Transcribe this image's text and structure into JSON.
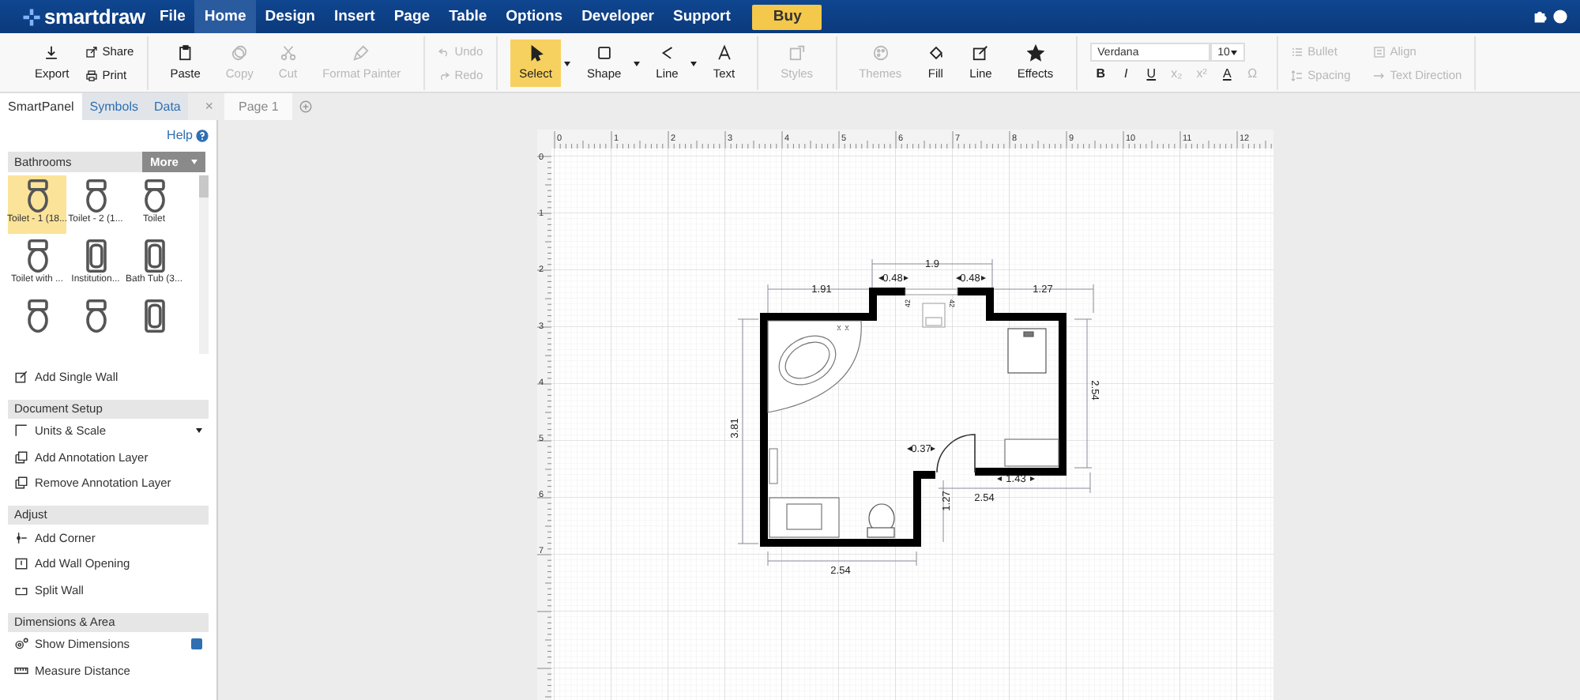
{
  "top_bar": {
    "logo": "smartdraw",
    "menu": [
      {
        "label": "File",
        "selected": false
      },
      {
        "label": "Home",
        "selected": true
      },
      {
        "label": "Design",
        "selected": false
      },
      {
        "label": "Insert",
        "selected": false
      },
      {
        "label": "Page",
        "selected": false
      },
      {
        "label": "Table",
        "selected": false
      },
      {
        "label": "Options",
        "selected": false
      },
      {
        "label": "Developer",
        "selected": false
      },
      {
        "label": "Support",
        "selected": false
      }
    ],
    "buy_button": "Buy"
  },
  "ribbon": {
    "groups": [
      {
        "kind": "buttons",
        "items": [
          {
            "label": "Export",
            "kind": "large",
            "disabled": false,
            "selected": false,
            "dropdown": false
          },
          {
            "label": "Share",
            "kind": "small",
            "disabled": false,
            "selected": false,
            "dropdown": false
          },
          {
            "label": "Print",
            "kind": "small",
            "disabled": false,
            "selected": false,
            "dropdown": false
          }
        ]
      },
      {
        "kind": "buttons",
        "items": [
          {
            "label": "Paste",
            "kind": "large",
            "disabled": false,
            "selected": false,
            "dropdown": false
          },
          {
            "label": "Copy",
            "kind": "large",
            "disabled": true,
            "selected": false,
            "dropdown": false
          },
          {
            "label": "Cut",
            "kind": "large",
            "disabled": true,
            "selected": false,
            "dropdown": false
          },
          {
            "label": "Format Painter",
            "kind": "large",
            "disabled": true,
            "selected": false,
            "dropdown": false
          }
        ]
      },
      {
        "kind": "buttons",
        "items": [
          {
            "label": "Undo",
            "kind": "small",
            "disabled": true,
            "selected": false,
            "dropdown": false
          },
          {
            "label": "Redo",
            "kind": "small",
            "disabled": true,
            "selected": false,
            "dropdown": false
          }
        ]
      },
      {
        "kind": "buttons",
        "items": [
          {
            "label": "Select",
            "kind": "large",
            "disabled": false,
            "selected": true,
            "dropdown": true
          },
          {
            "label": "Shape",
            "kind": "large",
            "disabled": false,
            "selected": false,
            "dropdown": true
          },
          {
            "label": "Line",
            "kind": "large",
            "disabled": false,
            "selected": false,
            "dropdown": true
          },
          {
            "label": "Text",
            "kind": "large",
            "disabled": false,
            "selected": false,
            "dropdown": false
          }
        ]
      },
      {
        "kind": "buttons",
        "items": [
          {
            "label": "Styles",
            "kind": "large",
            "disabled": true,
            "selected": false,
            "dropdown": false
          }
        ]
      },
      {
        "kind": "buttons",
        "items": [
          {
            "label": "Themes",
            "kind": "large",
            "disabled": true,
            "selected": false,
            "dropdown": false
          },
          {
            "label": "Fill",
            "kind": "large",
            "disabled": false,
            "selected": false,
            "dropdown": false
          },
          {
            "label": "Line",
            "kind": "large",
            "disabled": false,
            "selected": false,
            "dropdown": false
          },
          {
            "label": "Effects",
            "kind": "large",
            "disabled": false,
            "selected": false,
            "dropdown": false
          }
        ]
      },
      {
        "kind": "font",
        "font": "Verdana",
        "size": "10",
        "formats": [
          {
            "label": "B",
            "disabled": false
          },
          {
            "label": "I",
            "disabled": false
          },
          {
            "label": "U",
            "disabled": false
          },
          {
            "label": "x₂",
            "disabled": true
          },
          {
            "label": "x²",
            "disabled": true
          },
          {
            "label": "A",
            "disabled": false
          },
          {
            "label": "Ω",
            "disabled": true
          }
        ]
      },
      {
        "kind": "buttons",
        "items": [
          {
            "label": "Bullet",
            "kind": "small",
            "disabled": true,
            "selected": false,
            "dropdown": false
          },
          {
            "label": "Spacing",
            "kind": "small",
            "disabled": true,
            "selected": false,
            "dropdown": false
          },
          {
            "label": "Align",
            "kind": "small",
            "disabled": true,
            "selected": false,
            "dropdown": false
          },
          {
            "label": "Text Direction",
            "kind": "small",
            "disabled": true,
            "selected": false,
            "dropdown": false
          }
        ]
      }
    ]
  },
  "side_panel": {
    "tabs": [
      {
        "label": "SmartPanel",
        "selected": true
      },
      {
        "label": "Symbols",
        "selected": false
      },
      {
        "label": "Data",
        "selected": false
      }
    ],
    "close": "×",
    "help": "Help",
    "library": {
      "title": "Bathrooms",
      "more": "More",
      "symbols": [
        {
          "label": "Toilet - 1 (18...",
          "selected": true
        },
        {
          "label": "Toilet - 2 (1...",
          "selected": false
        },
        {
          "label": "Toilet",
          "selected": false
        },
        {
          "label": "Toilet with ...",
          "selected": false
        },
        {
          "label": "Institution...",
          "selected": false
        },
        {
          "label": "Bath Tub (3...",
          "selected": false
        },
        {
          "selected": false
        },
        {
          "selected": false
        },
        {
          "selected": false
        }
      ]
    },
    "add_wall": "Add Single Wall",
    "sections": [
      {
        "title": "Document Setup",
        "items": [
          {
            "label": "Units & Scale",
            "kind": "dropdown"
          },
          {
            "label": "Add Annotation Layer",
            "kind": "action"
          },
          {
            "label": "Remove Annotation Layer",
            "kind": "action"
          }
        ]
      },
      {
        "title": "Adjust",
        "items": [
          {
            "label": "Add Corner",
            "kind": "action"
          },
          {
            "label": "Add Wall Opening",
            "kind": "action"
          },
          {
            "label": "Split Wall",
            "kind": "action"
          }
        ]
      },
      {
        "title": "Dimensions & Area",
        "items": [
          {
            "label": "Show Dimensions",
            "kind": "checkbox",
            "checked": true
          },
          {
            "label": "Measure Distance",
            "kind": "action"
          }
        ]
      }
    ]
  },
  "page_tabs": {
    "tabs": [
      {
        "label": "Page 1",
        "selected": true
      }
    ]
  },
  "page": {
    "ruler": {
      "x_ticks": [
        "0",
        "1",
        "2",
        "3",
        "4",
        "5",
        "6",
        "7",
        "8",
        "9",
        "10",
        "11",
        "12"
      ],
      "y_ticks": [
        "0",
        "1",
        "2",
        "3",
        "4",
        "5",
        "6",
        "7"
      ]
    },
    "dimension_labels": [
      "1.9",
      "0.48",
      "0.48",
      "1.91",
      "1.27",
      "2.54",
      "3.81",
      "0.37",
      "1.43",
      "1.27",
      "2.54",
      "2.54",
      "42",
      "42"
    ]
  }
}
